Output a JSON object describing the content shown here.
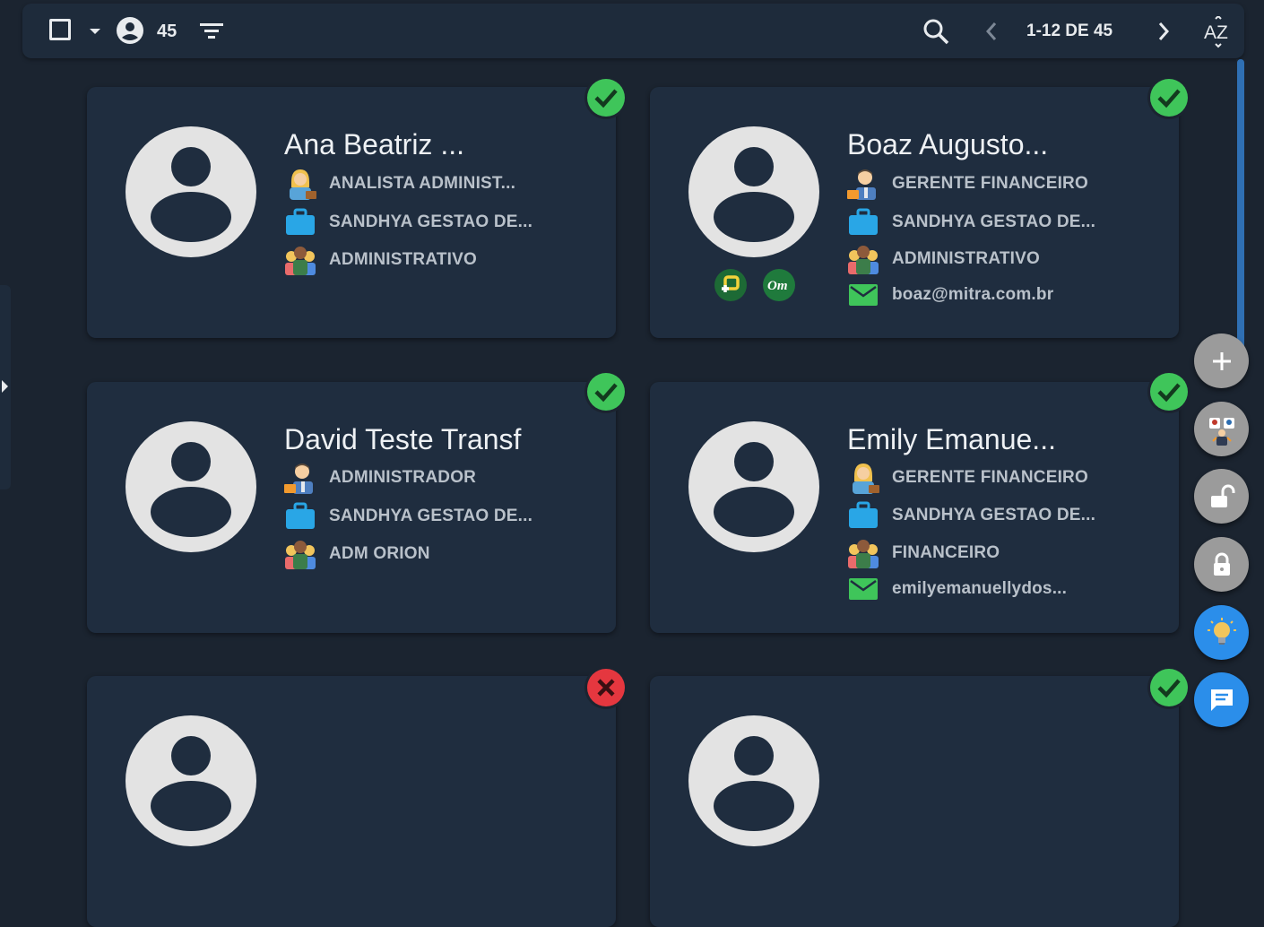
{
  "toolbar": {
    "user_count": "45",
    "pagination": "1-12 DE 45",
    "sort_label": "AZ"
  },
  "cards": [
    {
      "name": "Ana Beatriz ...",
      "role": "ANALISTA ADMINIST...",
      "company": "SANDHYA GESTAO DE...",
      "department": "ADMINISTRATIVO",
      "status": "active"
    },
    {
      "name": "Boaz Augusto...",
      "role": "GERENTE FINANCEIRO",
      "company": "SANDHYA GESTAO DE...",
      "department": "ADMINISTRATIVO",
      "email": "boaz@mitra.com.br",
      "apps": [
        "app-p-icon",
        "app-om-icon"
      ],
      "app_om_label": "Om",
      "status": "active"
    },
    {
      "name": "David Teste Transf",
      "role": "ADMINISTRADOR",
      "company": "SANDHYA GESTAO DE...",
      "department": "ADM ORION",
      "status": "active"
    },
    {
      "name": "Emily Emanue...",
      "role": "GERENTE FINANCEIRO",
      "company": "SANDHYA GESTAO DE...",
      "department": "FINANCEIRO",
      "email": "emilyemanuellydos...",
      "status": "active"
    },
    {
      "status": "inactive"
    },
    {
      "status": "active"
    }
  ],
  "fabs": [
    "add-icon",
    "team-icon",
    "unlock-icon",
    "lock-icon",
    "lightbulb-icon",
    "chat-icon"
  ],
  "colors": {
    "background": "#1b2430",
    "card": "#1f2d3f",
    "status_ok": "#3fc55a",
    "status_bad": "#e5373f",
    "accent_blue": "#2b8eea",
    "fab_grey": "#9b9b9b"
  }
}
